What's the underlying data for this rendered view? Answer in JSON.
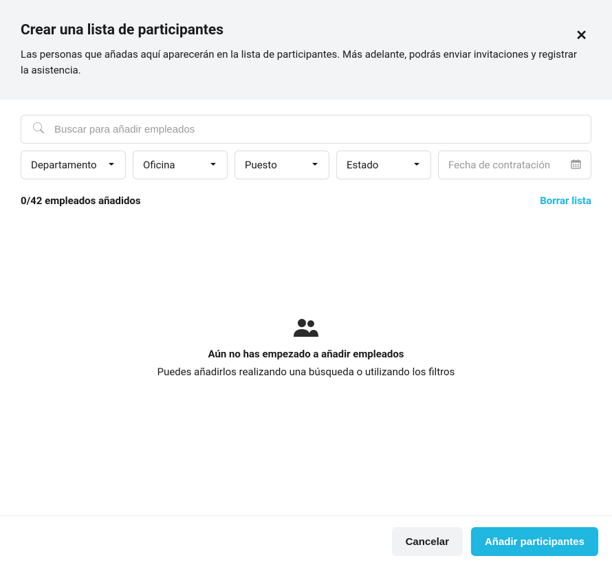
{
  "header": {
    "title": "Crear una lista de participantes",
    "description": "Las personas que añadas aquí aparecerán en la lista de participantes. Más adelante, podrás enviar invitaciones y registrar la asistencia."
  },
  "search": {
    "placeholder": "Buscar para añadir empleados"
  },
  "filters": {
    "department": "Departamento",
    "office": "Oficina",
    "position": "Puesto",
    "status": "Estado",
    "hire_date_placeholder": "Fecha de contratación"
  },
  "status_row": {
    "count_text": "0/42 empleados añadidos",
    "clear_label": "Borrar lista"
  },
  "empty_state": {
    "title": "Aún no has empezado a añadir empleados",
    "description": "Puedes añadirlos realizando una búsqueda o utilizando los filtros"
  },
  "footer": {
    "cancel_label": "Cancelar",
    "submit_label": "Añadir participantes"
  }
}
